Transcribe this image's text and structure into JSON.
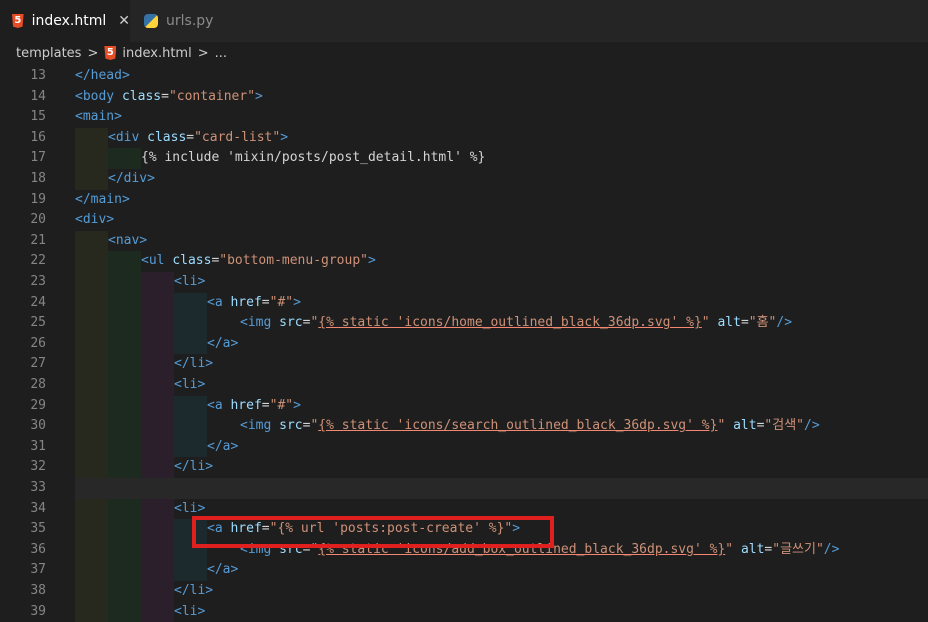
{
  "tabs": [
    {
      "label": "index.html",
      "icon": "html5-file-icon",
      "active": true,
      "close": "✕"
    },
    {
      "label": "urls.py",
      "icon": "python-file-icon",
      "active": false
    }
  ],
  "breadcrumb": {
    "folder": "templates",
    "separator": ">",
    "file": "index.html",
    "more": "..."
  },
  "colors": {
    "tag": "#569cd6",
    "attribute": "#9cdcfe",
    "string": "#ce9178",
    "highlight_box": "#e0201e"
  },
  "lines": [
    {
      "n": "13",
      "indent": 0,
      "code": [
        [
          "tag",
          "</head>"
        ]
      ]
    },
    {
      "n": "14",
      "indent": 0,
      "code": [
        [
          "tag",
          "<body "
        ],
        [
          "attr",
          "class"
        ],
        [
          "tx",
          "="
        ],
        [
          "str",
          "\"container\""
        ],
        [
          "tag",
          ">"
        ]
      ]
    },
    {
      "n": "15",
      "indent": 0,
      "code": [
        [
          "tag",
          "<main>"
        ]
      ]
    },
    {
      "n": "16",
      "indent": 1,
      "code": [
        [
          "tag",
          "<div "
        ],
        [
          "attr",
          "class"
        ],
        [
          "tx",
          "="
        ],
        [
          "str",
          "\"card-list\""
        ],
        [
          "tag",
          ">"
        ]
      ]
    },
    {
      "n": "17",
      "indent": 2,
      "code": [
        [
          "tx",
          "{% include 'mixin/posts/post_detail.html' %}"
        ]
      ]
    },
    {
      "n": "18",
      "indent": 1,
      "code": [
        [
          "tag",
          "</div>"
        ]
      ]
    },
    {
      "n": "19",
      "indent": 0,
      "code": [
        [
          "tag",
          "</main>"
        ]
      ]
    },
    {
      "n": "20",
      "indent": 0,
      "code": [
        [
          "tag",
          "<div>"
        ]
      ]
    },
    {
      "n": "21",
      "indent": 1,
      "code": [
        [
          "tag",
          "<nav>"
        ]
      ]
    },
    {
      "n": "22",
      "indent": 2,
      "code": [
        [
          "tag",
          "<ul "
        ],
        [
          "attr",
          "class"
        ],
        [
          "tx",
          "="
        ],
        [
          "str",
          "\"bottom-menu-group\""
        ],
        [
          "tag",
          ">"
        ]
      ]
    },
    {
      "n": "23",
      "indent": 3,
      "code": [
        [
          "tag",
          "<li>"
        ]
      ]
    },
    {
      "n": "24",
      "indent": 4,
      "code": [
        [
          "tag",
          "<a "
        ],
        [
          "attr",
          "href"
        ],
        [
          "tx",
          "="
        ],
        [
          "str",
          "\"#\""
        ],
        [
          "tag",
          ">"
        ]
      ]
    },
    {
      "n": "25",
      "indent": 5,
      "code": [
        [
          "tag",
          "<img "
        ],
        [
          "attr",
          "src"
        ],
        [
          "tx",
          "="
        ],
        [
          "str",
          "\""
        ],
        [
          "tpl",
          "{% static 'icons/home_outlined_black_36dp.svg' %}"
        ],
        [
          "str",
          "\""
        ],
        [
          "tx",
          " "
        ],
        [
          "attr",
          "alt"
        ],
        [
          "tx",
          "="
        ],
        [
          "str",
          "\"홈\""
        ],
        [
          "tag",
          "/>"
        ]
      ]
    },
    {
      "n": "26",
      "indent": 4,
      "code": [
        [
          "tag",
          "</a>"
        ]
      ]
    },
    {
      "n": "27",
      "indent": 3,
      "code": [
        [
          "tag",
          "</li>"
        ]
      ]
    },
    {
      "n": "28",
      "indent": 3,
      "code": [
        [
          "tag",
          "<li>"
        ]
      ]
    },
    {
      "n": "29",
      "indent": 4,
      "code": [
        [
          "tag",
          "<a "
        ],
        [
          "attr",
          "href"
        ],
        [
          "tx",
          "="
        ],
        [
          "str",
          "\"#\""
        ],
        [
          "tag",
          ">"
        ]
      ]
    },
    {
      "n": "30",
      "indent": 5,
      "code": [
        [
          "tag",
          "<img "
        ],
        [
          "attr",
          "src"
        ],
        [
          "tx",
          "="
        ],
        [
          "str",
          "\""
        ],
        [
          "tpl",
          "{% static 'icons/search_outlined_black_36dp.svg' %}"
        ],
        [
          "str",
          "\""
        ],
        [
          "tx",
          " "
        ],
        [
          "attr",
          "alt"
        ],
        [
          "tx",
          "="
        ],
        [
          "str",
          "\"검색\""
        ],
        [
          "tag",
          "/>"
        ]
      ]
    },
    {
      "n": "31",
      "indent": 4,
      "code": [
        [
          "tag",
          "</a>"
        ]
      ]
    },
    {
      "n": "32",
      "indent": 3,
      "code": [
        [
          "tag",
          "</li>"
        ]
      ]
    },
    {
      "n": "33",
      "indent": 0,
      "code": [],
      "current": true
    },
    {
      "n": "34",
      "indent": 3,
      "code": [
        [
          "tag",
          "<li>"
        ]
      ]
    },
    {
      "n": "35",
      "indent": 4,
      "code": [
        [
          "tag",
          "<a "
        ],
        [
          "attr",
          "href"
        ],
        [
          "tx",
          "="
        ],
        [
          "str",
          "\"{% url 'posts:post-create' %}\""
        ],
        [
          "tag",
          ">"
        ]
      ]
    },
    {
      "n": "36",
      "indent": 5,
      "code": [
        [
          "tag",
          "<img "
        ],
        [
          "attr",
          "src"
        ],
        [
          "tx",
          "="
        ],
        [
          "str",
          "\""
        ],
        [
          "tpl",
          "{% static 'icons/add_box_outlined_black_36dp.svg' %}"
        ],
        [
          "str",
          "\""
        ],
        [
          "tx",
          " "
        ],
        [
          "attr",
          "alt"
        ],
        [
          "tx",
          "="
        ],
        [
          "str",
          "\"글쓰기\""
        ],
        [
          "tag",
          "/>"
        ]
      ]
    },
    {
      "n": "37",
      "indent": 4,
      "code": [
        [
          "tag",
          "</a>"
        ]
      ]
    },
    {
      "n": "38",
      "indent": 3,
      "code": [
        [
          "tag",
          "</li>"
        ]
      ]
    },
    {
      "n": "39",
      "indent": 3,
      "code": [
        [
          "tag",
          "<li>"
        ]
      ]
    }
  ]
}
